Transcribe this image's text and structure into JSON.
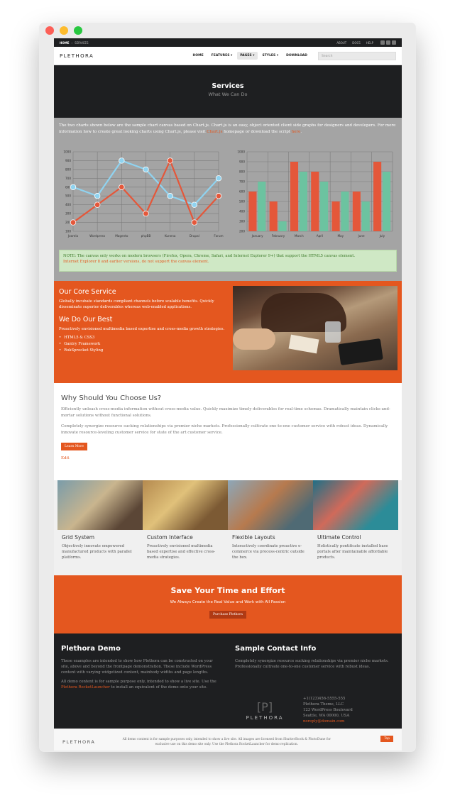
{
  "topbar": {
    "breadcrumb_home": "HOME",
    "breadcrumb_sep": "›",
    "breadcrumb_current": "SERVICES",
    "links": [
      "ABOUT",
      "DOCS",
      "HELP"
    ]
  },
  "nav": {
    "logo": "PLETHORA",
    "items": [
      "HOME",
      "FEATURES ▾",
      "PAGES ▾",
      "STYLES ▾",
      "DOWNLOAD"
    ],
    "search_placeholder": "Search"
  },
  "hero": {
    "title": "Services",
    "subtitle": "What We Can Do"
  },
  "intro": {
    "text1": "The two charts shown below are the sample chart canvas based on Chart.js. Chart.js is an easy, object oriented client side graphs for designers and developers. For more information how to create great looking charts using Chart.js, please visit ",
    "link1": "Chart.js",
    "text2": " homepage or download the script ",
    "link2": "here",
    "text3": "."
  },
  "chart_data": [
    {
      "type": "line",
      "categories": [
        "Joomla",
        "Wordpress",
        "Magento",
        "phpBB",
        "Kunena",
        "Drupal",
        "Forum"
      ],
      "series": [
        {
          "values": [
            600,
            500,
            900,
            800,
            500,
            400,
            700
          ],
          "color": "#8fd3f0"
        },
        {
          "values": [
            200,
            400,
            600,
            300,
            900,
            200,
            500
          ],
          "color": "#e4573a"
        }
      ],
      "yticks": [
        1000,
        900,
        800,
        700,
        600,
        500,
        400,
        300,
        200,
        100
      ],
      "ylim": [
        100,
        1000
      ],
      "grid": true
    },
    {
      "type": "bar",
      "categories": [
        "January",
        "February",
        "March",
        "April",
        "May",
        "June",
        "July"
      ],
      "series": [
        {
          "values": [
            600,
            500,
            900,
            800,
            500,
            600,
            900
          ],
          "color": "#e4573a"
        },
        {
          "values": [
            700,
            300,
            800,
            700,
            600,
            500,
            800
          ],
          "color": "#6cc3a0"
        }
      ],
      "yticks": [
        1000,
        900,
        800,
        700,
        600,
        500,
        400,
        300,
        200
      ],
      "ylim": [
        200,
        1000
      ],
      "grid": true
    }
  ],
  "note": {
    "line1": "NOTE: The canvas only works on modern browsers (Firefox, Opera, Chrome, Safari, and Internet Explorer 9+) that support the HTML5 canvas element.",
    "line2": "Internet Explorer 8 and earlier versions, do not support the canvas element."
  },
  "core": {
    "title": "Our Core Service",
    "text": "Globally incubate standards compliant channels before scalable benefits. Quickly disseminate superior deliverables whereas web-enabled applications.",
    "title2": "We Do Our Best",
    "text2": "Proactively envisioned multimedia based expertise and cross-media growth strategies.",
    "bullets": [
      "HTML5 & CSS3",
      "Gantry Framework",
      "RokSprocket Styling"
    ]
  },
  "why": {
    "title": "Why Should You Choose Us?",
    "p1": "Efficiently unleash cross-media information without cross-media value. Quickly maximize timely deliverables for real-time schemas. Dramatically maintain clicks-and-mortar solutions without functional solutions.",
    "p2": "Completely synergize resource sucking relationships via premier niche markets. Professionally cultivate one-to-one customer service with robust ideas. Dynamically innovate resource-leveling customer service for state of the art customer service.",
    "button": "Learn More",
    "edit": "Edit"
  },
  "features": [
    {
      "title": "Grid System",
      "text": "Objectively innovate empowered manufactured products with parallel platforms."
    },
    {
      "title": "Custom Interface",
      "text": "Proactively envisioned multimedia based expertise and effective cross-media strategies."
    },
    {
      "title": "Flexible Layouts",
      "text": "Interactively coordinate proactive e-commerce via process-centric outside the box."
    },
    {
      "title": "Ultimate Control",
      "text": "Holistically pontificate installed base portals after maintainable affordable products."
    }
  ],
  "cta": {
    "title": "Save Your Time and Effort",
    "subtitle": "We Always Create the Real Value and Work with All Passion",
    "button": "Purchase Plethora"
  },
  "footer": {
    "demo_title": "Plethora Demo",
    "demo_p1": "These examples are intended to show how Plethora can be constructed on your site, above and beyond the frontpage demonstration. These include WordPress content with varying widgetized content, mainbody widths and page lengths.",
    "demo_p2a": "All demo content is for sample purpose only, intended to show a live site. Use the ",
    "demo_link": "Plethora RocketLauncher",
    "demo_p2b": " to install an equivalent of the demo onto your site.",
    "contact_title": "Sample Contact Info",
    "contact_p": "Completely synergize resource sucking relationships via premier niche markets. Professionally cultivate one-to-one customer service with robust ideas.",
    "logo_mark": "[P]",
    "logo_text": "PLETHORA",
    "address": [
      "+1(123)456-5555-555",
      "Plethora Theme, LLC",
      "123 WordPress Boulevard",
      "Seattle, WA 00000, USA"
    ],
    "email": "noreply@domain.com"
  },
  "bottom": {
    "logo": "PLETHORA",
    "copy": "All demo content is for sample purposes only, intended to show a live site. All images are licensed from ShutterStock & PhotoDune for exclusive use on this demo site only. Use the Plethora RocketLauncher for demo replication.",
    "top": "Top"
  },
  "colors": {
    "accent": "#e4571f",
    "dark": "#1e1f21",
    "gray": "#a4a4a4",
    "note_bg": "#cfe8c5"
  }
}
